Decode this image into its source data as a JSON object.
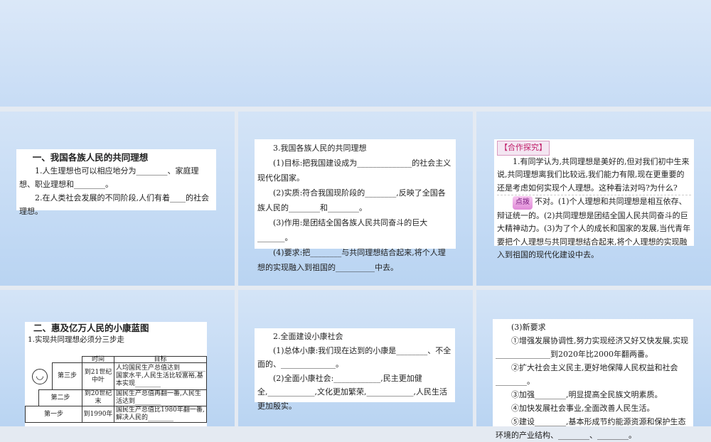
{
  "slide1": {
    "heading": "一、我国各族人民的共同理想",
    "lines": [
      "1.人生理想也可以相应地分为________、家庭理想、职业理想和________。",
      "2.在人类社会发展的不同阶段,人们有着____的社会理想。"
    ]
  },
  "slide2": {
    "lines": [
      "3.我国各族人民的共同理想",
      "(1)目标:把我国建设成为______________的社会主义现代化国家。",
      "(2)实质:符合我国现阶段的________,反映了全国各族人民的________和________。",
      "(3)作用:是团结全国各族人民共同奋斗的巨大_______。",
      "(4)要求:把________与共同理想结合起来,将个人理想的实现融入到祖国的__________中去。"
    ]
  },
  "slide3": {
    "tag": "【合作探究】",
    "question": "1.有同学认为,共同理想是美好的,但对我们初中生来说,共同理想离我们比较远,我们能力有限,现在更重要的还是考虑如何实现个人理想。这种看法对吗?为什么?",
    "hint_label": "点拨",
    "answer": "不对。(1)个人理想和共同理想是相互依存、辩证统一的。(2)共同理想是团结全国人民共同奋斗的巨大精神动力。(3)为了个人的成长和国家的发展,当代青年要把个人理想与共同理想结合起来,将个人理想的实现融入到祖国的现代化建设中去。"
  },
  "slide4": {
    "heading": "二、惠及亿万人民的小康蓝图",
    "subheading": "1.实现共同理想必须分三步走",
    "table": {
      "headers": [
        "时间",
        "目标"
      ],
      "rows": [
        {
          "step": "第三步",
          "time": "到21世纪中叶",
          "goal": "人均国民生产总值达到________国家水平,人民生活比较富裕,基本实现________"
        },
        {
          "step": "第二步",
          "time": "到20世纪末",
          "goal": "国民生产总值再翻一番,人民生活达到________"
        },
        {
          "step": "第一步",
          "time": "到1990年",
          "goal": "国民生产总值比1980年翻一番,解决人民的________"
        }
      ]
    }
  },
  "slide5": {
    "lines": [
      "2.全面建设小康社会",
      "(1)总体小康:我们现在达到的小康是________、不全面的、______________。",
      "(2)全面小康社会:____________,民主更加健全,____________,文化更加繁荣,____________,人民生活更加殷实。"
    ]
  },
  "slide6": {
    "lines": [
      "(3)新要求",
      "①增强发展协调性,努力实现经济又好又快发展,实现______________到2020年比2000年翻两番。",
      "②扩大社会主义民主,更好地保障人民权益和社会________。",
      "③加强________,明显提高全民族文明素质。",
      "④加快发展社会事业,全面改善人民生活。",
      "⑤建设________,基本形成节约能源资源和保护生态环境的产业结构、________、________。"
    ]
  }
}
